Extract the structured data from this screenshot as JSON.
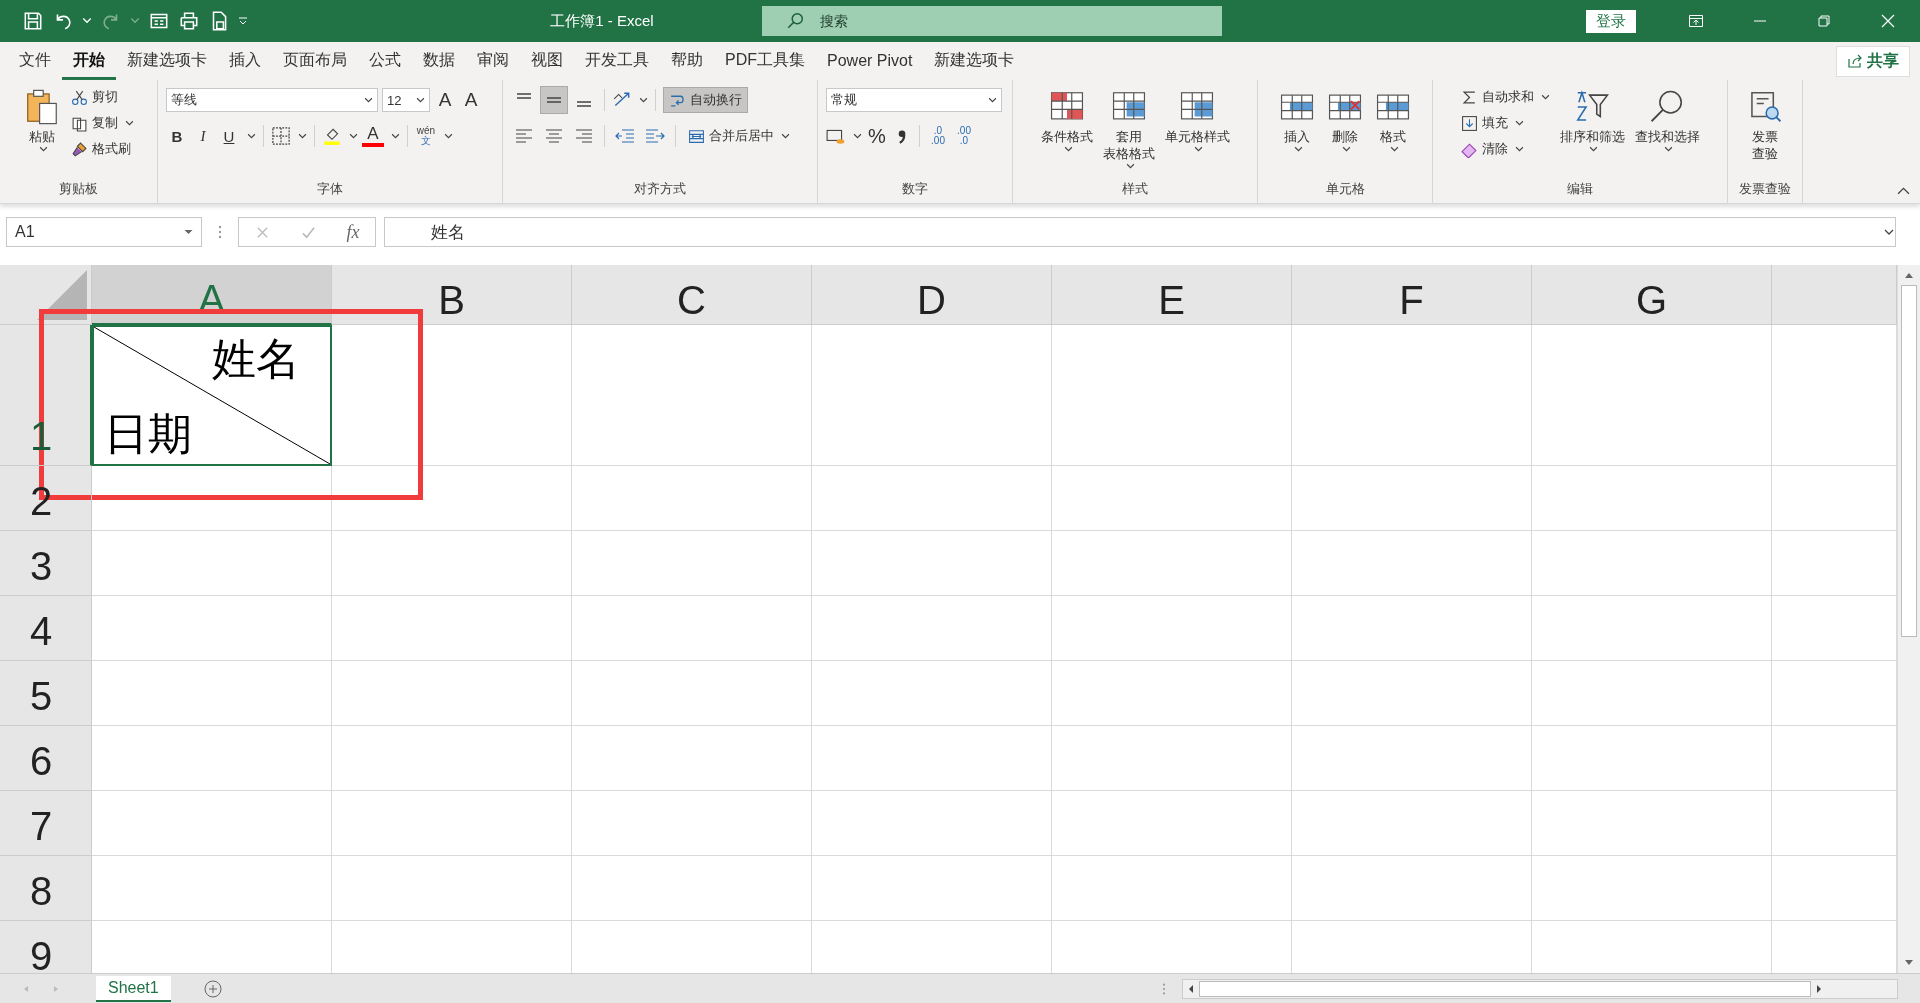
{
  "window": {
    "title": "工作簿1  -  Excel",
    "login": "登录"
  },
  "search": {
    "placeholder": "搜索"
  },
  "menu_tabs": [
    {
      "label": "文件",
      "selected": false
    },
    {
      "label": "开始",
      "selected": true
    },
    {
      "label": "新建选项卡",
      "selected": false
    },
    {
      "label": "插入",
      "selected": false
    },
    {
      "label": "页面布局",
      "selected": false
    },
    {
      "label": "公式",
      "selected": false
    },
    {
      "label": "数据",
      "selected": false
    },
    {
      "label": "审阅",
      "selected": false
    },
    {
      "label": "视图",
      "selected": false
    },
    {
      "label": "开发工具",
      "selected": false
    },
    {
      "label": "帮助",
      "selected": false
    },
    {
      "label": "PDF工具集",
      "selected": false
    },
    {
      "label": "Power Pivot",
      "selected": false
    },
    {
      "label": "新建选项卡",
      "selected": false
    }
  ],
  "share": "共享",
  "ribbon": {
    "clipboard": {
      "title": "剪贴板",
      "paste": "粘贴",
      "small": [
        "剪切",
        "复制",
        "格式刷"
      ]
    },
    "font": {
      "title": "字体",
      "font_name": "等线",
      "font_size": "12",
      "grow": "A",
      "shrink": "A",
      "styles": [
        "B",
        "I",
        "U"
      ],
      "font_color": "A",
      "phonetic_top": "wén",
      "phonetic_bottom": "文"
    },
    "alignment": {
      "title": "对齐方式",
      "vertical_align": [
        {
          "selected": false
        },
        {
          "selected": true
        },
        {
          "selected": false
        }
      ],
      "wrap_text": {
        "label": "自动换行",
        "selected": true
      },
      "merge": "合并后居中"
    },
    "number": {
      "title": "数字",
      "format": "常规",
      "percent": "%",
      "increase_decimal": [
        ".0",
        ".00"
      ],
      "decrease_decimal": [
        ".00",
        ".0"
      ]
    },
    "styles": {
      "title": "样式",
      "buttons": [
        {
          "lines": [
            "条件格式"
          ]
        },
        {
          "lines": [
            "套用",
            "表格格式"
          ]
        },
        {
          "lines": [
            "单元格样式"
          ]
        }
      ]
    },
    "cells": {
      "title": "单元格",
      "buttons": [
        {
          "lines": [
            "插入"
          ]
        },
        {
          "lines": [
            "删除"
          ]
        },
        {
          "lines": [
            "格式"
          ]
        }
      ]
    },
    "editing": {
      "title": "编辑",
      "small": [
        "自动求和",
        "填充",
        "清除"
      ],
      "buttons": [
        {
          "lines": [
            "排序和筛选"
          ]
        },
        {
          "lines": [
            "查找和选择"
          ]
        }
      ]
    },
    "invoice": {
      "title": "发票查验",
      "buttons": [
        {
          "lines": [
            "发票",
            "查验"
          ]
        }
      ]
    }
  },
  "formula_bar": {
    "name_box": "A1",
    "fx": "fx",
    "content": "姓名"
  },
  "columns": [
    {
      "label": "A",
      "selected": true
    },
    {
      "label": "B",
      "selected": false
    },
    {
      "label": "C",
      "selected": false
    },
    {
      "label": "D",
      "selected": false
    },
    {
      "label": "E",
      "selected": false
    },
    {
      "label": "F",
      "selected": false
    },
    {
      "label": "G",
      "selected": false
    }
  ],
  "rows": [
    {
      "label": "1",
      "selected": true,
      "cells": [
        {
          "kind": "diagonal",
          "top": "姓名",
          "bottom": "日期"
        }
      ]
    },
    {
      "label": "2",
      "selected": false
    },
    {
      "label": "3",
      "selected": false
    },
    {
      "label": "4",
      "selected": false
    },
    {
      "label": "5",
      "selected": false
    },
    {
      "label": "6",
      "selected": false
    },
    {
      "label": "7",
      "selected": false
    },
    {
      "label": "8",
      "selected": false
    },
    {
      "label": "9",
      "selected": false
    }
  ],
  "sheet_tabs": [
    {
      "label": "Sheet1",
      "selected": true
    }
  ]
}
